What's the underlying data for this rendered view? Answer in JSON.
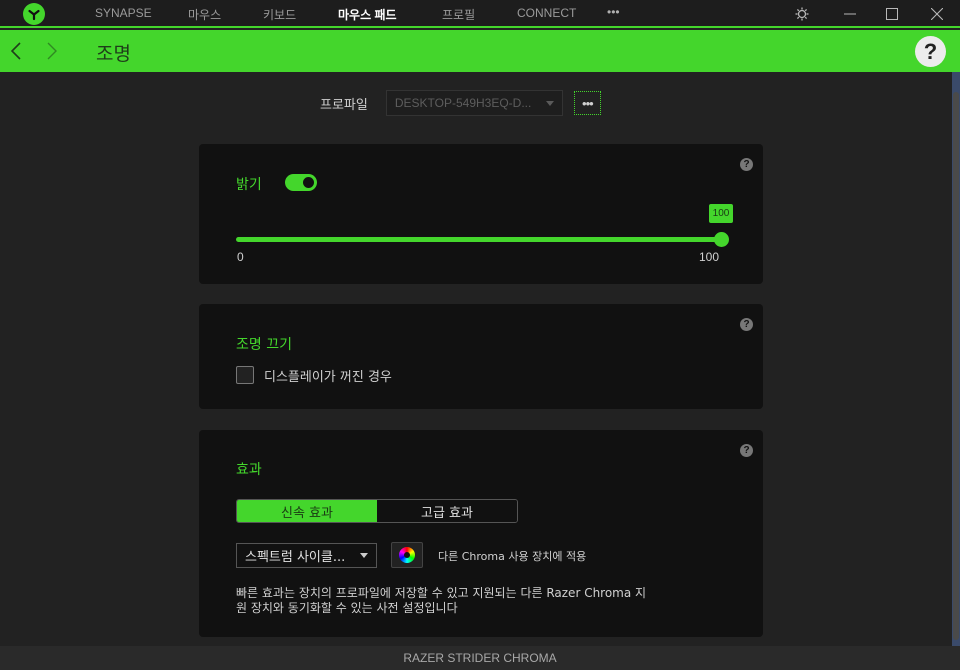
{
  "titlebar": {
    "nav": [
      {
        "label": "SYNAPSE",
        "active": false
      },
      {
        "label": "마우스",
        "active": false
      },
      {
        "label": "키보드",
        "active": false
      },
      {
        "label": "마우스 패드",
        "active": true
      },
      {
        "label": "프로필",
        "active": false
      },
      {
        "label": "CONNECT",
        "active": false
      }
    ],
    "more_label": "•••",
    "icons": {
      "logo": "razer-logo-icon",
      "settings": "gear-icon",
      "minimize": "minimize-icon",
      "maximize": "maximize-icon",
      "close": "close-icon"
    }
  },
  "header": {
    "title": "조명",
    "help_label": "?"
  },
  "profile": {
    "label": "프로파일",
    "selected": "DESKTOP-549H3EQ-D...",
    "more_label": "•••"
  },
  "brightness": {
    "title": "밝기",
    "enabled": true,
    "value": 100,
    "value_label": "100",
    "min_label": "0",
    "max_label": "100",
    "min": 0,
    "max": 100,
    "help_label": "?"
  },
  "lighting_off": {
    "title": "조명 끄기",
    "checkbox_label": "디스플레이가 꺼진 경우",
    "checked": false,
    "help_label": "?"
  },
  "effects": {
    "title": "효과",
    "tabs": [
      {
        "label": "신속 효과",
        "active": true
      },
      {
        "label": "고급 효과",
        "active": false
      }
    ],
    "selected_effect": "스펙트럼 사이클...",
    "chroma_apply_label": "다른 Chroma 사용 장치에 적용",
    "description": "빠른 효과는 장치의 프로파일에 저장할 수 있고 지원되는 다른 Razer Chroma 지원 장치와 동기화할 수 있는 사전 설정입니다",
    "help_label": "?"
  },
  "footer": {
    "device_name": "RAZER STRIDER CHROMA"
  },
  "colors": {
    "accent": "#44d62c",
    "background": "#222222",
    "card": "#111111"
  }
}
